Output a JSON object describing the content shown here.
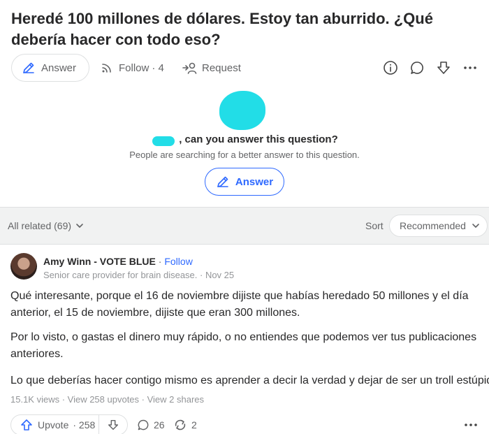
{
  "question": {
    "title": "Heredé 100 millones de dólares. Estoy tan aburrido. ¿Qué debería hacer con todo eso?"
  },
  "question_actions": {
    "answer_label": "Answer",
    "follow_label": "Follow",
    "follow_count": "· 4",
    "request_label": "Request",
    "icons": [
      "info-icon",
      "comment-icon",
      "downvote-icon",
      "more-icon"
    ]
  },
  "cta": {
    "prompt": ", can you answer this question?",
    "subtext": "People are searching for a better answer to this question.",
    "answer_label": "Answer"
  },
  "related": {
    "label": "All related (69)",
    "sort_label": "Sort",
    "sort_value": "Recommended"
  },
  "answer": {
    "author_name": "Amy Winn - VOTE BLUE",
    "separator": " · ",
    "follow_label": "Follow",
    "author_credential": "Senior care provider for brain disease. · Nov 25",
    "paragraphs": [
      [
        "Qué interesante, porque el 16 de noviembre dijiste que habías heredado 50 millones y el día",
        "anterior, el 15 de noviembre, dijiste que eran 300 millones."
      ],
      [
        "Por lo visto, o gastas el dinero muy rápido, o no entiendes que podemos ver tus publicaciones",
        "anteriores."
      ],
      [
        "Lo que deberías hacer contigo mismo es aprender a decir la verdad y dejar de ser un troll estúpido"
      ]
    ],
    "stats": "15.1K views · View 258 upvotes · View 2 shares",
    "upvote_label": "Upvote",
    "upvote_count": "· 258",
    "comment_count": "26",
    "share_count": "2"
  },
  "colors": {
    "accent": "#2e69ff",
    "redaction": "#22dde7",
    "text": "#282829",
    "muted": "#636466",
    "background": "#f1f2f2"
  }
}
